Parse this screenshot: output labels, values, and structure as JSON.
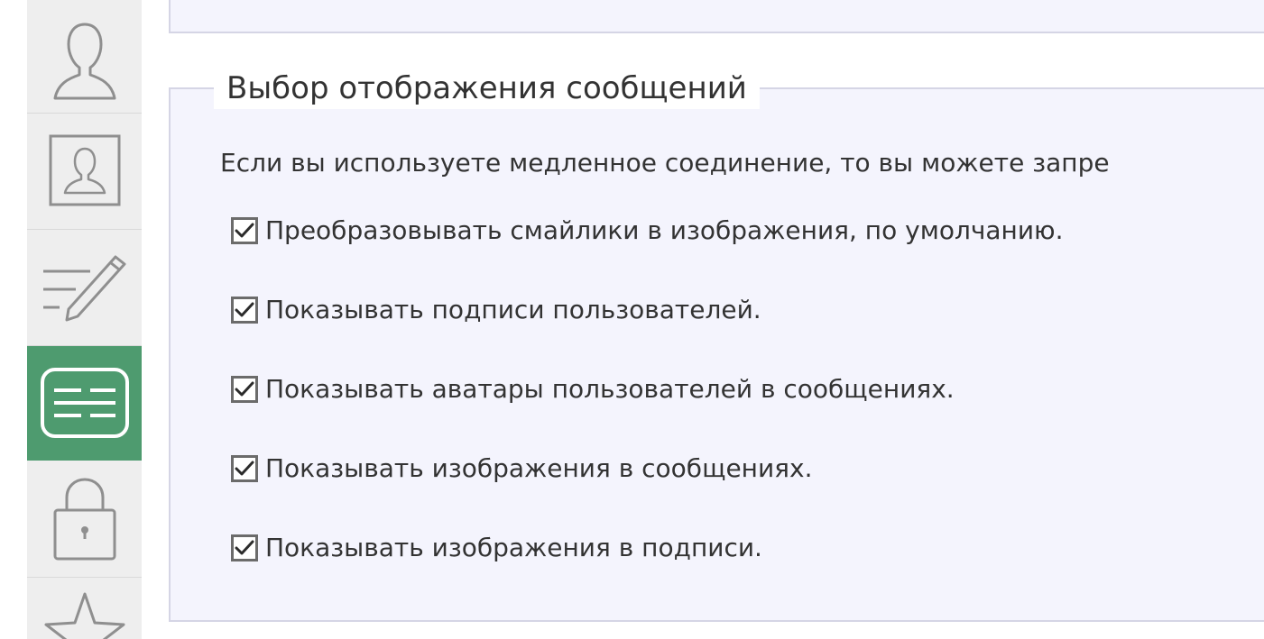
{
  "sidebar": {
    "tabs": [
      {
        "icon": "user-outline-icon",
        "active": false
      },
      {
        "icon": "user-card-icon",
        "active": false
      },
      {
        "icon": "edit-signature-icon",
        "active": false
      },
      {
        "icon": "post-display-icon",
        "active": true
      },
      {
        "icon": "lock-icon",
        "active": false
      },
      {
        "icon": "star-icon",
        "active": false
      }
    ],
    "active_color": "#4e9b6f"
  },
  "section": {
    "legend": "Выбор отображения сообщений",
    "description": "Если вы используете медленное соединение, то вы можете запре",
    "options": [
      {
        "label": "Преобразовывать смайлики в изображения, по умолчанию.",
        "checked": true
      },
      {
        "label": "Показывать подписи пользователей.",
        "checked": true
      },
      {
        "label": "Показывать аватары пользователей в сообщениях.",
        "checked": true
      },
      {
        "label": "Показывать изображения в сообщениях.",
        "checked": true
      },
      {
        "label": "Показывать изображения в подписи.",
        "checked": true
      }
    ]
  }
}
